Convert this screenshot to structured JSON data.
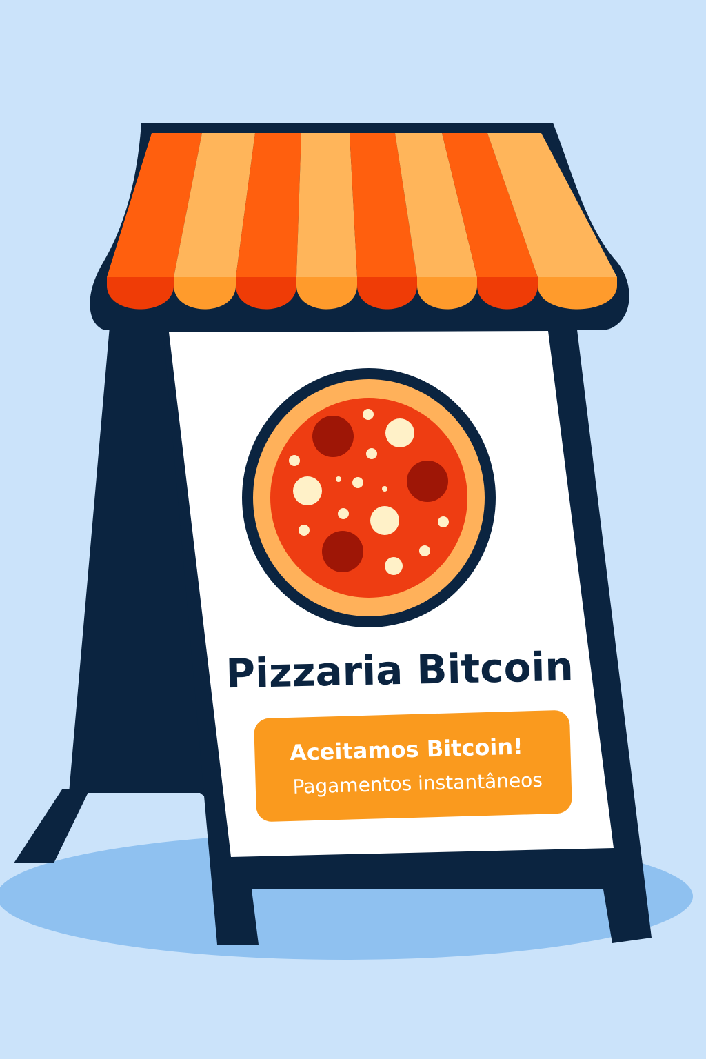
{
  "sign": {
    "title": "Pizzaria Bitcoin",
    "badge": {
      "headline": "Aceitamos Bitcoin!",
      "subtext": "Pagamentos instantâneos"
    }
  },
  "colors": {
    "background": "#cbe3fa",
    "shadow": "#8fc1f0",
    "frame": "#0b2440",
    "panel": "#ffffff",
    "awning_dark_stripe": "#ff5f0e",
    "awning_light_stripe": "#ffb55a",
    "awning_dark_scallop": "#ef3c06",
    "awning_light_scallop": "#ff9b2c",
    "badge": "#fa9a1e",
    "pizza_crust": "#ffb15a",
    "pizza_sauce": "#ee3d12",
    "pepperoni": "#9e1606",
    "cheese": "#fff1c8"
  },
  "icons": {
    "pizza": "pizza-icon",
    "awning": "striped-awning"
  }
}
